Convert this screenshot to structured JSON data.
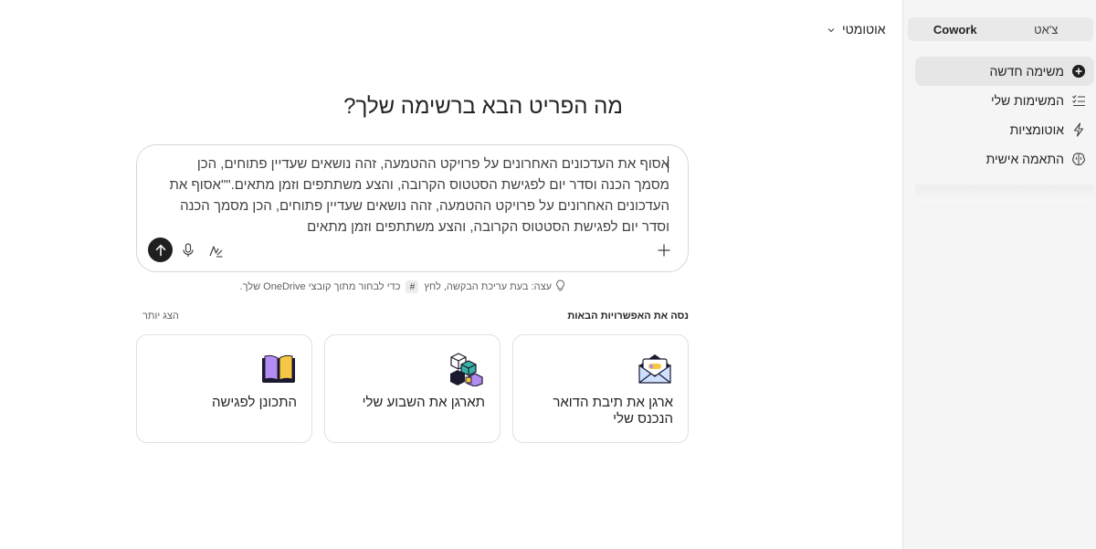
{
  "sidebar": {
    "tabs": [
      {
        "label": "צ'אט",
        "active": false
      },
      {
        "label": "Cowork",
        "active": true
      }
    ],
    "items": [
      {
        "label": "משימה חדשה",
        "icon": "add-circle-icon",
        "active": true
      },
      {
        "label": "המשימות שלי",
        "icon": "checklist-icon",
        "active": false
      },
      {
        "label": "אוטומציות",
        "icon": "lightning-icon",
        "active": false
      },
      {
        "label": "התאמה אישית",
        "icon": "brain-icon",
        "active": false
      }
    ]
  },
  "header": {
    "model_label": "אוטומטי"
  },
  "main": {
    "heading": "מה הפריט הבא ברשימה שלך?",
    "composer": {
      "text": "אסוף את העדכונים האחרונים על פרויקט ההטמעה, זהה נושאים שעדיין פתוחים, הכן מסמך הכנה וסדר יום לפגישת הסטטוס הקרובה, והצע משתתפים וזמן מתאים.\"\"אסוף את העדכונים האחרונים על פרויקט ההטמעה, זהה נושאים שעדיין פתוחים, הכן מסמך הכנה וסדר יום לפגישת הסטטוס הקרובה, והצע משתתפים וזמן מתאים"
    },
    "tip": {
      "before": "עצה: בעת עריכת הבקשה, לחץ",
      "key": "#",
      "after": "כדי לבחור מתוך קובצי OneDrive שלך."
    },
    "suggestions": {
      "title": "נסה את האפשרויות הבאות",
      "show_more": "הצג יותר",
      "cards": [
        {
          "label": "ארגן את תיבת הדואר הנכנס שלי",
          "icon": "mail-icon"
        },
        {
          "label": "תארגן את השבוע שלי",
          "icon": "cubes-icon"
        },
        {
          "label": "התכונן לפגישה",
          "icon": "book-icon"
        }
      ]
    }
  },
  "colors": {
    "sidebar_bg": "#f5f5f5",
    "send_button": "#1f1f1f",
    "accent_purple": "#b48bf2",
    "accent_yellow": "#f5c744",
    "accent_teal": "#38b2a4"
  }
}
